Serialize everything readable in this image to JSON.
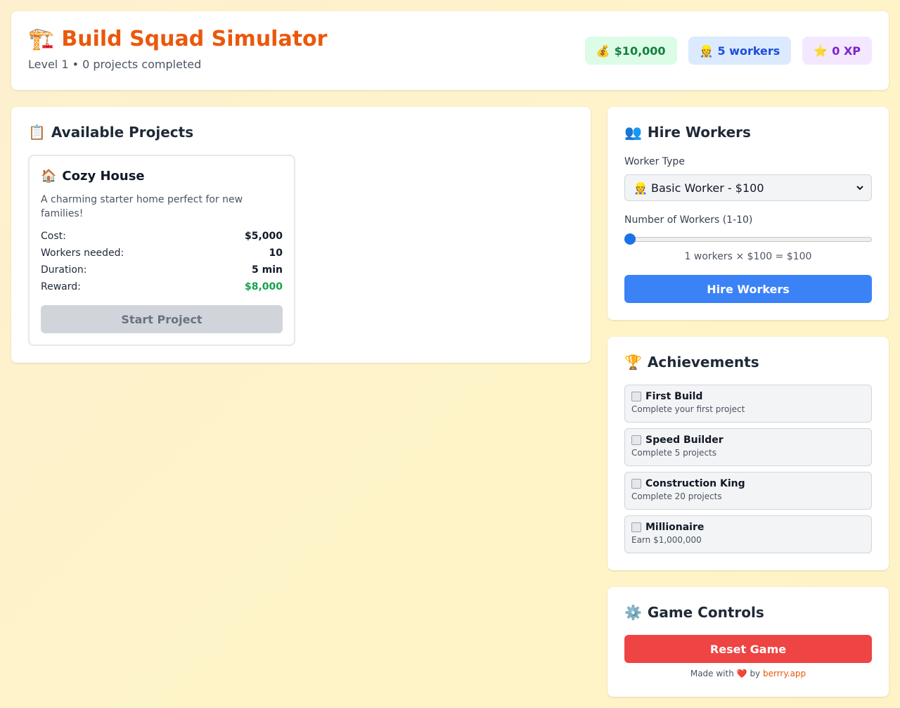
{
  "header": {
    "icon": "🏗️",
    "title": "Build Squad Simulator",
    "subtitle": "Level 1 • 0 projects completed",
    "stats": {
      "money_icon": "💰",
      "money": "$10,000",
      "workers_icon": "👷",
      "workers": "5 workers",
      "xp_icon": "⭐",
      "xp": "0 XP"
    }
  },
  "projects": {
    "icon": "📋",
    "title": "Available Projects",
    "items": [
      {
        "icon": "🏠",
        "name": "Cozy House",
        "description": "A charming starter home perfect for new families!",
        "cost_label": "Cost:",
        "cost": "$5,000",
        "workers_label": "Workers needed:",
        "workers": "10",
        "duration_label": "Duration:",
        "duration": "5 min",
        "reward_label": "Reward:",
        "reward": "$8,000",
        "button": "Start Project"
      }
    ]
  },
  "hire": {
    "icon": "👥",
    "title": "Hire Workers",
    "type_label": "Worker Type",
    "type_icon": "👷",
    "type_value": "Basic Worker - $100",
    "count_label": "Number of Workers (1-10)",
    "count_min": 1,
    "count_max": 10,
    "count_value": 1,
    "calc": "1 workers × $100 = $100",
    "button": "Hire Workers"
  },
  "achievements": {
    "icon": "🏆",
    "title": "Achievements",
    "items": [
      {
        "name": "First Build",
        "description": "Complete your first project"
      },
      {
        "name": "Speed Builder",
        "description": "Complete 5 projects"
      },
      {
        "name": "Construction King",
        "description": "Complete 20 projects"
      },
      {
        "name": "Millionaire",
        "description": "Earn $1,000,000"
      }
    ]
  },
  "controls": {
    "icon": "⚙️",
    "title": "Game Controls",
    "reset_button": "Reset Game",
    "footer_prefix": "Made with",
    "footer_heart": "❤️",
    "footer_by": "by",
    "footer_link": "berrry.app"
  },
  "colors": {
    "accent_orange": "#ea580c",
    "money_green": "#15803d",
    "workers_blue": "#1d4ed8",
    "xp_purple": "#7e22ce",
    "primary_blue": "#3b82f6",
    "danger_red": "#ef4444"
  }
}
